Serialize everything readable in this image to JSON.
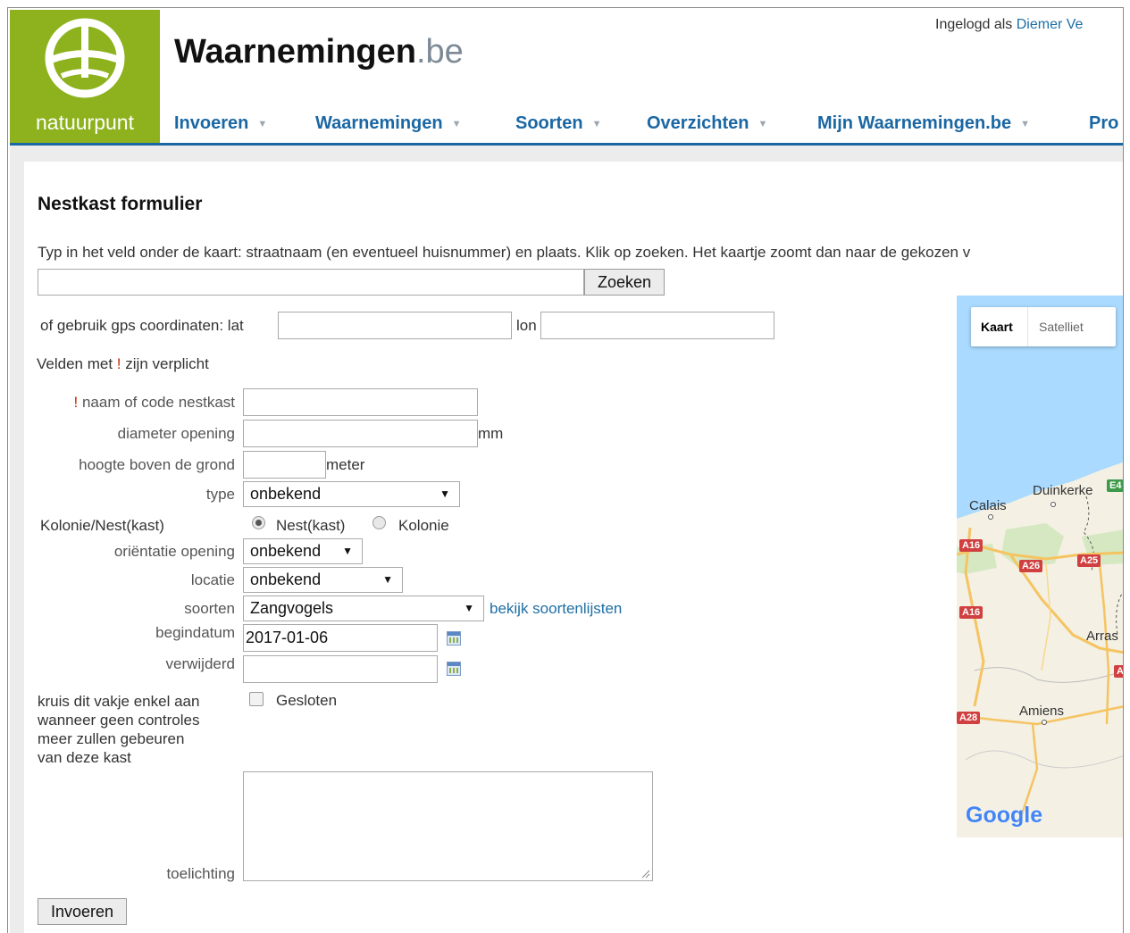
{
  "header": {
    "logo_text": "natuurpunt",
    "site_name": "Waarnemingen",
    "site_tld": ".be",
    "login_prefix": "Ingelogd als",
    "login_user": "Diemer Ve",
    "nav": [
      "Invoeren",
      "Waarnemingen",
      "Soorten",
      "Overzichten",
      "Mijn Waarnemingen.be",
      "Pro"
    ]
  },
  "form": {
    "title": "Nestkast formulier",
    "intro": "Typ in het veld onder de kaart: straatnaam (en eventueel huisnummer) en plaats. Klik op zoeken. Het kaartje zoomt dan naar de gekozen v",
    "search_button": "Zoeken",
    "gps_label": "of gebruik gps coordinaten: lat",
    "lon_label": "lon",
    "required_note_pre": "Velden met",
    "required_mark": "!",
    "required_note_post": "zijn verplicht",
    "name_label": "naam of code nestkast",
    "diameter_label": "diameter opening",
    "diameter_unit": "mm",
    "height_label": "hoogte boven de grond",
    "height_unit": "meter",
    "type_label": "type",
    "type_value": "onbekend",
    "colony_label": "Kolonie/Nest(kast)",
    "radio_nest": "Nest(kast)",
    "radio_colony": "Kolonie",
    "orientation_label": "oriëntatie opening",
    "orientation_value": "onbekend",
    "location_label": "locatie",
    "location_value": "onbekend",
    "species_label": "soorten",
    "species_value": "Zangvogels",
    "species_link": "bekijk soortenlijsten",
    "start_label": "begindatum",
    "start_value": "2017-01-06",
    "removed_label": "verwijderd",
    "removed_value": "",
    "closed_note": [
      "kruis dit vakje enkel aan",
      "wanneer geen controles",
      "meer zullen gebeuren",
      "van deze kast"
    ],
    "closed_label": "Gesloten",
    "remarks_label": "toelichting",
    "submit_button": "Invoeren"
  },
  "map": {
    "tab_map": "Kaart",
    "tab_satellite": "Satelliet",
    "cities": [
      "Calais",
      "Duinkerke",
      "Arras",
      "Amiens"
    ],
    "roads": [
      "A16",
      "A26",
      "A25",
      "A16",
      "A28",
      "E4",
      "A"
    ],
    "brand": "Google",
    "colors": {
      "land": "#f4f0e4",
      "water": "#aadaff",
      "forest": "#cfe6b7",
      "road": "#f5c462"
    }
  }
}
